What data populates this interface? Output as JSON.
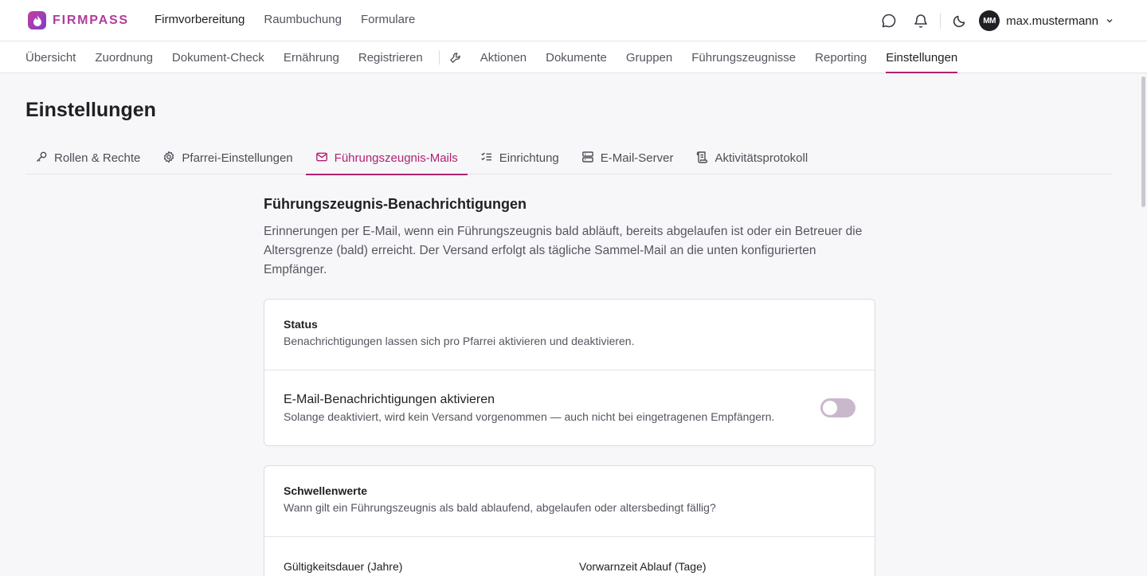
{
  "brand": {
    "name": "FIRMPASS",
    "logo_icon": "flame-icon",
    "accent": "#b0226f"
  },
  "main_nav": [
    {
      "label": "Firmvorbereitung",
      "active": true
    },
    {
      "label": "Raumbuchung",
      "active": false
    },
    {
      "label": "Formulare",
      "active": false
    }
  ],
  "user": {
    "initials": "MM",
    "name": "max.mustermann"
  },
  "sub_nav": {
    "left": [
      "Übersicht",
      "Zuordnung",
      "Dokument-Check",
      "Ernährung",
      "Registrieren"
    ],
    "right": [
      "Aktionen",
      "Dokumente",
      "Gruppen",
      "Führungszeugnisse",
      "Reporting",
      "Einstellungen"
    ],
    "active": "Einstellungen"
  },
  "page": {
    "title": "Einstellungen"
  },
  "tabs": [
    {
      "label": "Rollen & Rechte",
      "icon": "key-icon"
    },
    {
      "label": "Pfarrei-Einstellungen",
      "icon": "gear-icon"
    },
    {
      "label": "Führungszeugnis-Mails",
      "icon": "mail-icon",
      "active": true
    },
    {
      "label": "Einrichtung",
      "icon": "checklist-icon"
    },
    {
      "label": "E-Mail-Server",
      "icon": "server-icon"
    },
    {
      "label": "Aktivitätsprotokoll",
      "icon": "log-icon"
    }
  ],
  "section": {
    "title": "Führungszeugnis-Benachrichtigungen",
    "description": "Erinnerungen per E-Mail, wenn ein Führungszeugnis bald abläuft, bereits abgelaufen ist oder ein Betreuer die Altersgrenze (bald) erreicht. Der Versand erfolgt als tägliche Sammel-Mail an die unten konfigurierten Empfänger."
  },
  "status_card": {
    "title": "Status",
    "subtitle": "Benachrichtigungen lassen sich pro Pfarrei aktivieren und deaktivieren.",
    "toggle_label": "E-Mail-Benachrichtigungen aktivieren",
    "toggle_hint": "Solange deaktiviert, wird kein Versand vorgenommen — auch nicht bei eingetragenen Empfängern.",
    "enabled": false
  },
  "threshold_card": {
    "title": "Schwellenwerte",
    "subtitle": "Wann gilt ein Führungszeugnis als bald ablaufend, abgelaufen oder altersbedingt fällig?",
    "field1_label": "Gültigkeitsdauer (Jahre)",
    "field2_label": "Vorwarnzeit Ablauf (Tage)"
  }
}
